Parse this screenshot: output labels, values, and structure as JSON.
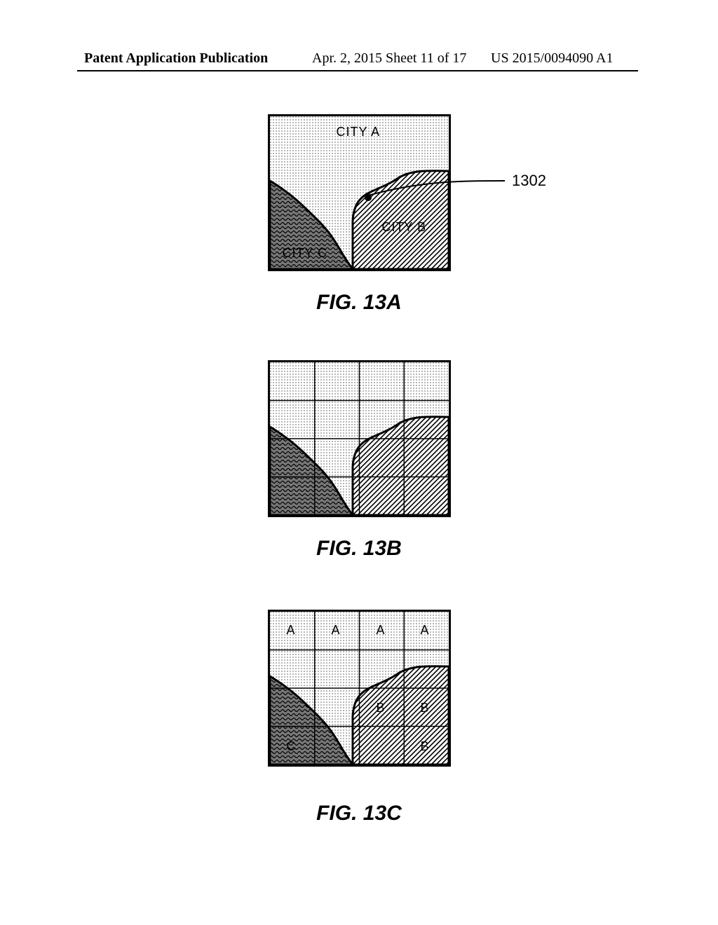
{
  "header": {
    "left": "Patent Application Publication",
    "center": "Apr. 2, 2015  Sheet 11 of 17",
    "right": "US 2015/0094090 A1"
  },
  "figA": {
    "caption": "FIG. 13A",
    "labels": {
      "a": "CITY A",
      "b": "CITY B",
      "c": "CITY C"
    },
    "callout_ref": "1302"
  },
  "figB": {
    "caption": "FIG. 13B"
  },
  "figC": {
    "caption": "FIG. 13C",
    "cells": {
      "r0c0": "A",
      "r0c1": "A",
      "r0c2": "A",
      "r0c3": "A",
      "r2c2": "B",
      "r2c3": "B",
      "r3c0": "C",
      "r3c3": "B"
    }
  }
}
